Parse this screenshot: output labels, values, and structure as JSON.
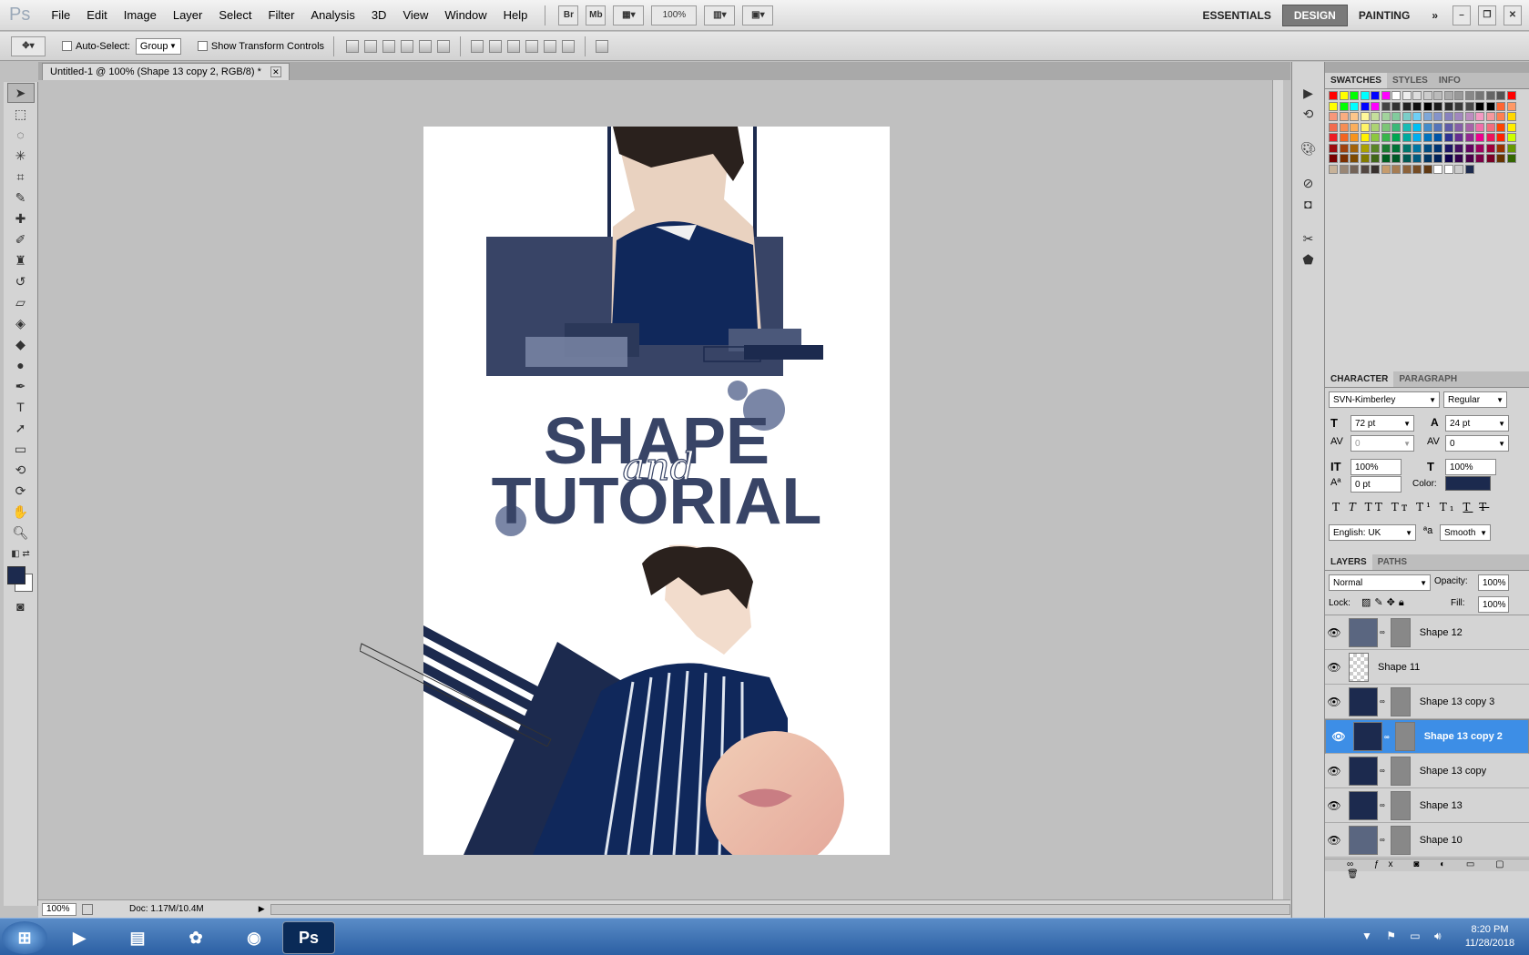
{
  "app": {
    "logo": "Ps"
  },
  "menu": [
    "File",
    "Edit",
    "Image",
    "Layer",
    "Select",
    "Filter",
    "Analysis",
    "3D",
    "View",
    "Window",
    "Help"
  ],
  "appbar": {
    "br": "Br",
    "mb": "Mb",
    "zoom": "100%"
  },
  "workspaces": [
    "ESSENTIALS",
    "DESIGN",
    "PAINTING"
  ],
  "options": {
    "auto_select": "Auto-Select:",
    "auto_select_value": "Group",
    "show_transform": "Show Transform Controls"
  },
  "document": {
    "tab_title": "Untitled-1 @ 100% (Shape 13 copy 2, RGB/8) *"
  },
  "status": {
    "zoom": "100%",
    "doc": "Doc: 1.17M/10.4M"
  },
  "canvas_text": {
    "line1": "SHAPE",
    "script": "and",
    "line2": "TUTORIAL"
  },
  "colors": {
    "navy": "#1c2a4e",
    "slate": "#384466",
    "muted": "#7a86a6",
    "selected": "#3d8ee6"
  },
  "swatches_panel": {
    "tabs": [
      "SWATCHES",
      "STYLES",
      "INFO"
    ]
  },
  "character": {
    "tabs": [
      "CHARACTER",
      "PARAGRAPH"
    ],
    "font": "SVN-Kimberley",
    "style": "Regular",
    "size": "72 pt",
    "leading": "24 pt",
    "kerning": "0",
    "tracking": "0",
    "vscale": "100%",
    "hscale": "100%",
    "baseline": "0 pt",
    "color_label": "Color:",
    "language": "English: UK",
    "aa_label": "a",
    "antialias": "Smooth"
  },
  "layers_panel": {
    "tabs": [
      "LAYERS",
      "PATHS"
    ],
    "blend": "Normal",
    "opacity_label": "Opacity:",
    "opacity": "100%",
    "lock_label": "Lock:",
    "fill_label": "Fill:",
    "fill": "100%",
    "layers": [
      {
        "name": "Shape 12",
        "selected": false
      },
      {
        "name": "Shape 11",
        "selected": false
      },
      {
        "name": "Shape 13 copy 3",
        "selected": false
      },
      {
        "name": "Shape 13 copy 2",
        "selected": true
      },
      {
        "name": "Shape 13 copy",
        "selected": false
      },
      {
        "name": "Shape 13",
        "selected": false
      },
      {
        "name": "Shape 10",
        "selected": false
      }
    ]
  },
  "taskbar": {
    "time": "8:20 PM",
    "date": "11/28/2018"
  }
}
